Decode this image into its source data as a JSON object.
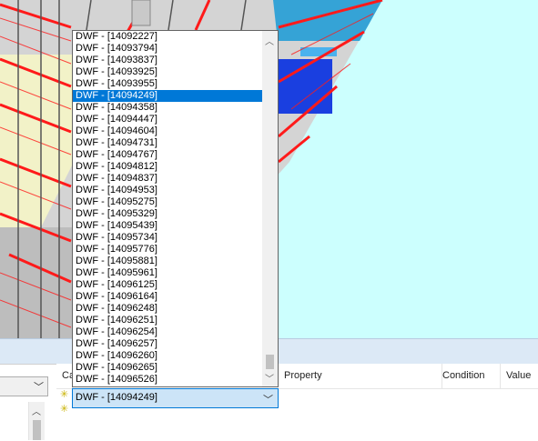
{
  "dropdown": {
    "items": [
      "DWF - [14092227]",
      "DWF - [14093794]",
      "DWF - [14093837]",
      "DWF - [14093925]",
      "DWF - [14093955]",
      "DWF - [14094249]",
      "DWF - [14094358]",
      "DWF - [14094447]",
      "DWF - [14094604]",
      "DWF - [14094731]",
      "DWF - [14094767]",
      "DWF - [14094812]",
      "DWF - [14094837]",
      "DWF - [14094953]",
      "DWF - [14095275]",
      "DWF - [14095329]",
      "DWF - [14095439]",
      "DWF - [14095734]",
      "DWF - [14095776]",
      "DWF - [14095881]",
      "DWF - [14095961]",
      "DWF - [14096125]",
      "DWF - [14096164]",
      "DWF - [14096248]",
      "DWF - [14096251]",
      "DWF - [14096254]",
      "DWF - [14096257]",
      "DWF - [14096260]",
      "DWF - [14096265]",
      "DWF - [14096526]"
    ],
    "selected_index": 5
  },
  "combo": {
    "value": "DWF - [14094249]"
  },
  "grid": {
    "columns": {
      "category": "Ca",
      "property": "Property",
      "condition": "Condition",
      "value": "Value"
    }
  },
  "colors": {
    "selection": "#0078d7",
    "viewport_bg": "#ccfffe",
    "structure_red": "#ff1a1a"
  }
}
